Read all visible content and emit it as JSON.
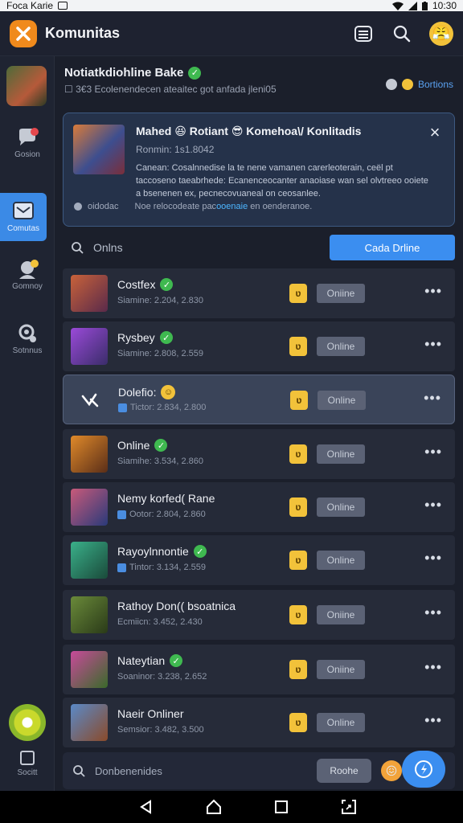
{
  "statusbar": {
    "left_text": "Foca Karie",
    "time": "10:30"
  },
  "app": {
    "title": "Komunitas"
  },
  "header_icons": [
    "list-icon",
    "search-icon",
    "profile-emoji-icon"
  ],
  "rail": {
    "items": [
      {
        "label": "Gosion",
        "icon": "chat-icon",
        "badge_color": "#e5484d"
      },
      {
        "label": "Comutas",
        "icon": "inbox-icon",
        "active": true
      },
      {
        "label": "Gomnoy",
        "icon": "group-icon",
        "badge_color": "#f2c23a"
      },
      {
        "label": "Sotnnus",
        "icon": "settings-icon"
      }
    ],
    "bottom_label": "Socitt"
  },
  "profile": {
    "name": "Notiatkdiohline Bake",
    "subtitle": "☐ 3€3 Ecolenendecen ateaitec got anfada jleni05",
    "right_link": "Bortions"
  },
  "announcement": {
    "title": "Mahed 😆 Rotiant 😎 Komehoa\\/ Konlitadis",
    "meta": "Ronmin: 1s1.8042",
    "body": "Canean: Cosalnnedise la te nene vamanen carerleoterain, ceël pt taccoseno taeabrhede: Ecanenceocanter anaoiase wan sel olvtreeo ooiete a bsenenen ex, pecnecovuaneal on ceosanlee.",
    "foot_left": "oidodac",
    "foot_rest_a": "Noe relocodeate pac",
    "foot_highlight": "ooenaie",
    "foot_rest_b": " en oenderanoe."
  },
  "search": {
    "placeholder": "Onlns",
    "button_label": "Cada Drline"
  },
  "list": {
    "rows": [
      {
        "name": "Costfex",
        "sub": "Siamine: 2.204, 2.830",
        "status": "Oniine",
        "verified": true,
        "thumb_a": "#c8623a",
        "thumb_b": "#5a2a4a"
      },
      {
        "name": "Rysbey",
        "sub": "Siamine: 2.808, 2.559",
        "status": "Online",
        "verified": true,
        "thumb_a": "#9a4ad8",
        "thumb_b": "#3a2d6a"
      },
      {
        "name": "Dolefio:",
        "sub": "Tictor: 2.834, 2.800",
        "status": "Online",
        "emoji": true,
        "highlight": true
      },
      {
        "name": "Online",
        "sub": "Siamihe: 3.534, 2.860",
        "status": "Online",
        "verified": true,
        "thumb_a": "#e08a2a",
        "thumb_b": "#5a2e18"
      },
      {
        "name": "Nemy korfed( Rane",
        "sub": "Ootor: 2.804, 2.860",
        "status": "Online",
        "square": true,
        "thumb_a": "#c85a7a",
        "thumb_b": "#2a3a7a"
      },
      {
        "name": "Rayoylnnontie",
        "sub": "Tintor: 3.134, 2.559",
        "status": "Online",
        "verified": true,
        "square": true,
        "thumb_a": "#3ab08a",
        "thumb_b": "#1a4a3a"
      },
      {
        "name": "Rathoy Don(( bsoatnica",
        "sub": "Ecmiicn: 3.452, 2.430",
        "status": "Oniine",
        "thumb_a": "#6a8a3a",
        "thumb_b": "#2a3a18"
      },
      {
        "name": "Nateytian",
        "sub": "Soaninor: 3.238, 2.652",
        "status": "Oniine",
        "verified": true,
        "thumb_a": "#c84a9a",
        "thumb_b": "#3a6a2a"
      },
      {
        "name": "Naeir Onliner",
        "sub": "Semsior: 3.482, 3.500",
        "status": "Online",
        "thumb_a": "#5a8ac8",
        "thumb_b": "#8a4a2a"
      }
    ]
  },
  "compose": {
    "placeholder": "Donbenenides",
    "button_label": "Roohe"
  },
  "colors": {
    "accent": "#3b8ef0",
    "verified": "#3fb950",
    "shield": "#f2c23a",
    "background": "#1b1f2b"
  },
  "navbar": [
    "back-icon",
    "home-icon",
    "recents-icon",
    "screenshot-icon"
  ]
}
